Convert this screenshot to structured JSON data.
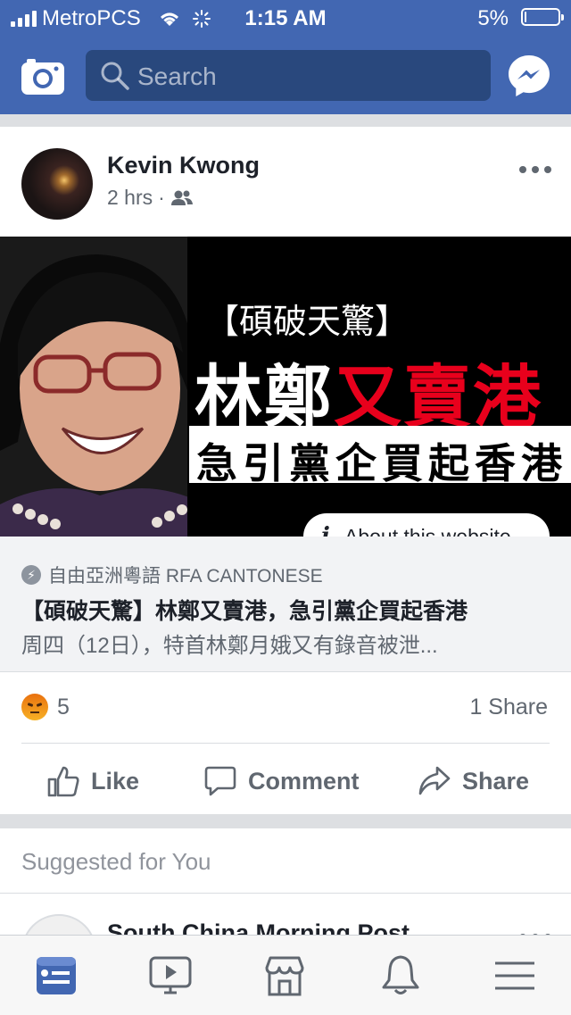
{
  "status_bar": {
    "carrier": "MetroPCS",
    "time": "1:15 AM",
    "battery": "5%",
    "battery_level": 0.05
  },
  "navbar": {
    "search_placeholder": "Search"
  },
  "post": {
    "author": "Kevin Kwong",
    "time": "2 hrs",
    "separator": "·",
    "image": {
      "headline": "【碩破天驚】",
      "title_white": "林鄭",
      "title_red": "又賣港",
      "subtitle": "急引黨企買起香港"
    },
    "about_button": "About this website",
    "link": {
      "source": "自由亞洲粵語 RFA CANTONESE",
      "title": "【碩破天驚】林鄭又賣港，急引黨企買起香港",
      "description": "周四（12日），特首林鄭月娥又有錄音被泄..."
    },
    "reaction_count": "5",
    "share_count": "1 Share",
    "actions": {
      "like": "Like",
      "comment": "Comment",
      "share": "Share"
    }
  },
  "suggested": {
    "heading": "Suggested for You",
    "page_name": "South China Morning Post"
  },
  "colors": {
    "brand": "#4267b2",
    "search_bg": "#29487d",
    "angry": "#f2951b"
  },
  "icons": [
    "camera-icon",
    "search-icon",
    "messenger-icon",
    "friends-icon",
    "more-icon",
    "info-icon",
    "bolt-icon",
    "angry-reaction-icon",
    "like-icon",
    "comment-icon",
    "share-icon",
    "news-feed-icon",
    "watch-icon",
    "marketplace-icon",
    "notifications-icon",
    "menu-icon"
  ]
}
